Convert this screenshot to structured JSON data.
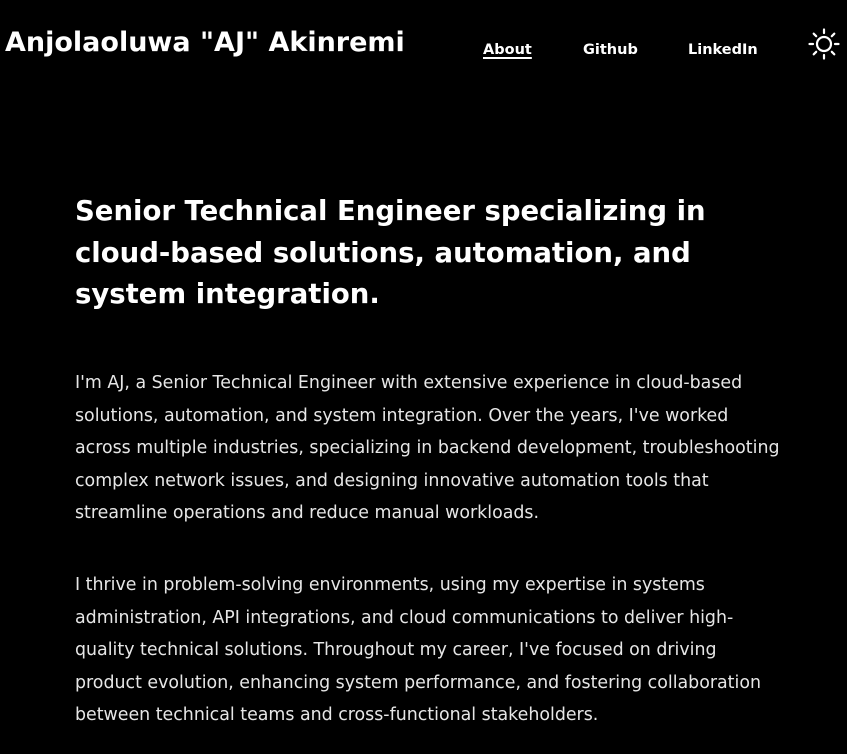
{
  "header": {
    "site_title": "Anjolaoluwa \"AJ\" Akinremi",
    "nav": {
      "about": "About",
      "github": "Github",
      "linkedin": "LinkedIn"
    },
    "active_nav": "About",
    "theme_toggle_icon": "sun-icon"
  },
  "main": {
    "headline": "Senior Technical Engineer specializing in cloud-based solutions, automation, and system integration.",
    "paragraphs": [
      "I'm AJ, a Senior Technical Engineer with extensive experience in cloud-based solutions, automation, and system integration. Over the years, I've worked across multiple industries, specializing in backend development, troubleshooting complex network issues, and designing innovative automation tools that streamline operations and reduce manual workloads.",
      "I thrive in problem-solving environments, using my expertise in systems administration, API integrations, and cloud communications to deliver high-quality technical solutions. Throughout my career, I've focused on driving product evolution, enhancing system performance, and fostering collaboration between technical teams and cross-functional stakeholders."
    ]
  },
  "colors": {
    "background": "#000000",
    "text": "#ffffff",
    "body_text": "#e6e6e6"
  }
}
